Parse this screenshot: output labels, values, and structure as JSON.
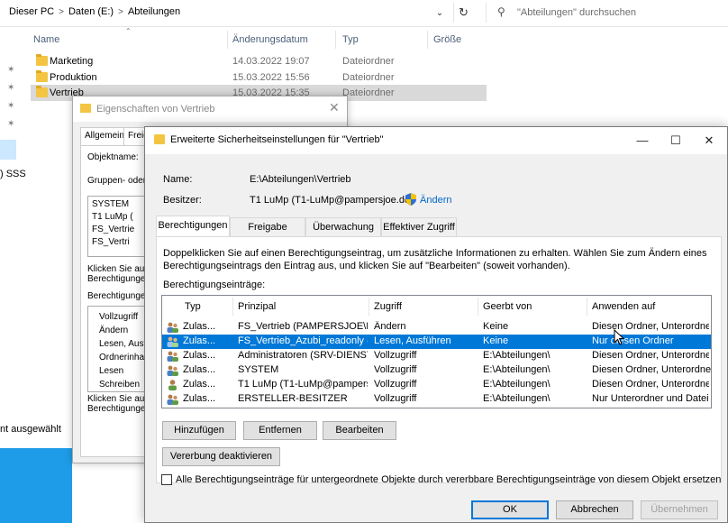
{
  "explorer": {
    "breadcrumb": [
      "Dieser PC",
      "Daten (E:)",
      "Abteilungen"
    ],
    "search_placeholder": "\"Abteilungen\" durchsuchen",
    "columns": {
      "name": "Name",
      "date": "Änderungsdatum",
      "type": "Typ",
      "size": "Größe"
    },
    "files": [
      {
        "name": "Marketing",
        "date": "14.03.2022 19:07",
        "type": "Dateiordner"
      },
      {
        "name": "Produktion",
        "date": "15.03.2022 15:56",
        "type": "Dateiordner"
      },
      {
        "name": "Vertrieb",
        "date": "15.03.2022 15:35",
        "type": "Dateiordner"
      }
    ],
    "nav_partial": ") SSS",
    "status": "nt ausgewählt"
  },
  "props": {
    "title": "Eigenschaften von Vertrieb",
    "tabs": [
      "Allgemein",
      "Freig"
    ],
    "objectname_label": "Objektname:",
    "groups_label": "Gruppen- oder B",
    "groups": [
      "SYSTEM",
      "T1 LuMp (",
      "FS_Vertrie",
      "FS_Vertri"
    ],
    "hint": [
      "Klicken Sie auf",
      "Berechtigungen"
    ],
    "perm_label": "Berechtigungen",
    "perms": [
      "Vollzugriff",
      "Ändern",
      "Lesen, Ausfü",
      "Ordnerinhalt a",
      "Lesen",
      "Schreiben"
    ],
    "hint2": [
      "Klicken Sie auf",
      "Berechtigungen"
    ]
  },
  "adv": {
    "title": "Erweiterte Sicherheitseinstellungen für \"Vertrieb\"",
    "name_label": "Name:",
    "name_value": "E:\\Abteilungen\\Vertrieb",
    "owner_label": "Besitzer:",
    "owner_value": "T1 LuMp (T1-LuMp@pampersjoe.de)",
    "change_link": "Ändern",
    "tabs": [
      "Berechtigungen",
      "Freigabe",
      "Überwachung",
      "Effektiver Zugriff"
    ],
    "info_line1": "Doppelklicken Sie auf einen Berechtigungseintrag, um zusätzliche Informationen zu erhalten. Wählen Sie zum Ändern eines",
    "info_line2": "Berechtigungseintrags den Eintrag aus, und klicken Sie auf \"Bearbeiten\" (soweit vorhanden).",
    "entries_label": "Berechtigungseinträge:",
    "headers": [
      "Typ",
      "Prinzipal",
      "Zugriff",
      "Geerbt von",
      "Anwenden auf"
    ],
    "rows": [
      {
        "typ": "Zulas...",
        "prinzipal": "FS_Vertrieb (PAMPERSJOE\\FS_...",
        "zugriff": "Ändern",
        "geerbt": "Keine",
        "anwenden": "Diesen Ordner, Unterordner un...",
        "icon": "group-icon"
      },
      {
        "typ": "Zulas...",
        "prinzipal": "FS_Vertrieb_Azubi_readonly (P...",
        "zugriff": "Lesen, Ausführen",
        "geerbt": "Keine",
        "anwenden": "Nur diesen Ordner",
        "icon": "group-icon"
      },
      {
        "typ": "Zulas...",
        "prinzipal": "Administratoren (SRV-DIENST...",
        "zugriff": "Vollzugriff",
        "geerbt": "E:\\Abteilungen\\",
        "anwenden": "Diesen Ordner, Unterordner un...",
        "icon": "group-icon"
      },
      {
        "typ": "Zulas...",
        "prinzipal": "SYSTEM",
        "zugriff": "Vollzugriff",
        "geerbt": "E:\\Abteilungen\\",
        "anwenden": "Diesen Ordner, Unterordner und...",
        "icon": "group-icon"
      },
      {
        "typ": "Zulas...",
        "prinzipal": "T1 LuMp (T1-LuMp@pampers...",
        "zugriff": "Vollzugriff",
        "geerbt": "E:\\Abteilungen\\",
        "anwenden": "Diesen Ordner, Unterordner un...",
        "icon": "user-icon"
      },
      {
        "typ": "Zulas...",
        "prinzipal": "ERSTELLER-BESITZER",
        "zugriff": "Vollzugriff",
        "geerbt": "E:\\Abteilungen\\",
        "anwenden": "Nur Unterordner und Dateien",
        "icon": "group-icon"
      }
    ],
    "buttons": {
      "add": "Hinzufügen",
      "remove": "Entfernen",
      "edit": "Bearbeiten",
      "inherit": "Vererbung deaktivieren"
    },
    "replace_checkbox": "Alle Berechtigungseinträge für untergeordnete Objekte durch vererbbare Berechtigungseinträge von diesem Objekt ersetzen",
    "footer": {
      "ok": "OK",
      "cancel": "Abbrechen",
      "apply": "Übernehmen"
    }
  },
  "colors": {
    "selection": "#0078d7",
    "link": "#0066cc",
    "folder": "#f4c542",
    "taskbar": "#1e9ce8"
  }
}
